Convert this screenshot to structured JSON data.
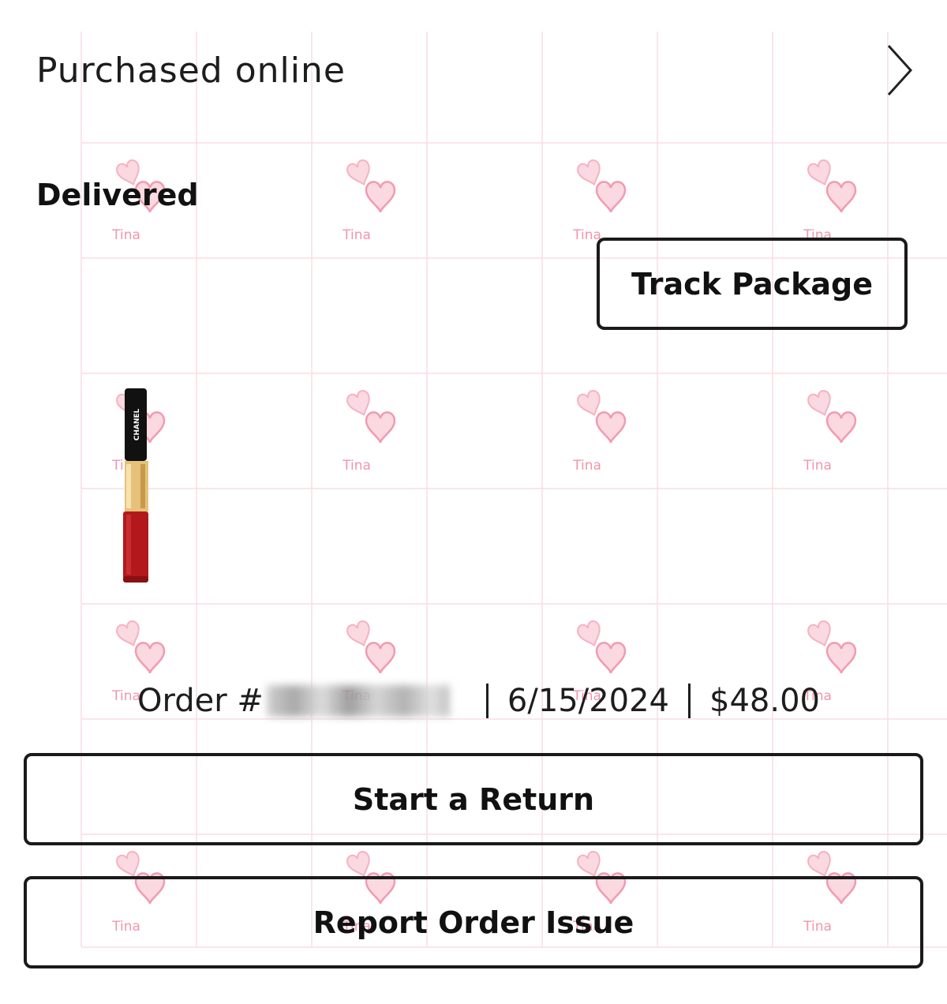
{
  "header": {
    "purchase_channel": "Purchased online"
  },
  "shipment": {
    "status": "Delivered",
    "track_button_label": "Track Package"
  },
  "product": {
    "brand": "CHANEL"
  },
  "order": {
    "label": "Order #",
    "date": "6/15/2024",
    "total": "$48.00"
  },
  "actions": {
    "return_label": "Start a Return",
    "report_label": "Report Order Issue"
  },
  "watermark": {
    "text": "Tina",
    "icon": "hearts-icon",
    "grid_color": "#f6d5dc",
    "heart_color": "#f3a6b7"
  }
}
